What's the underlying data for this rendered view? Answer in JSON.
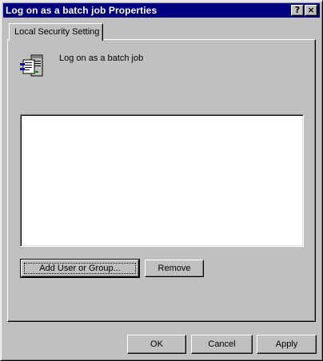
{
  "window": {
    "title": "Log on as a batch job Properties",
    "help_glyph": "?",
    "close_glyph": "×"
  },
  "tabs": [
    {
      "label": "Local Security Setting",
      "selected": true
    }
  ],
  "policy": {
    "icon": "policy-server-document-icon",
    "label": "Log on as a batch job"
  },
  "members": {
    "items": []
  },
  "buttons": {
    "add_label": "Add User or Group...",
    "remove_label": "Remove",
    "ok_label": "OK",
    "cancel_label": "Cancel",
    "apply_label": "Apply"
  },
  "colors": {
    "titlebar": "#000080",
    "face": "#c0c0c0",
    "list_bg": "#ffffff"
  }
}
